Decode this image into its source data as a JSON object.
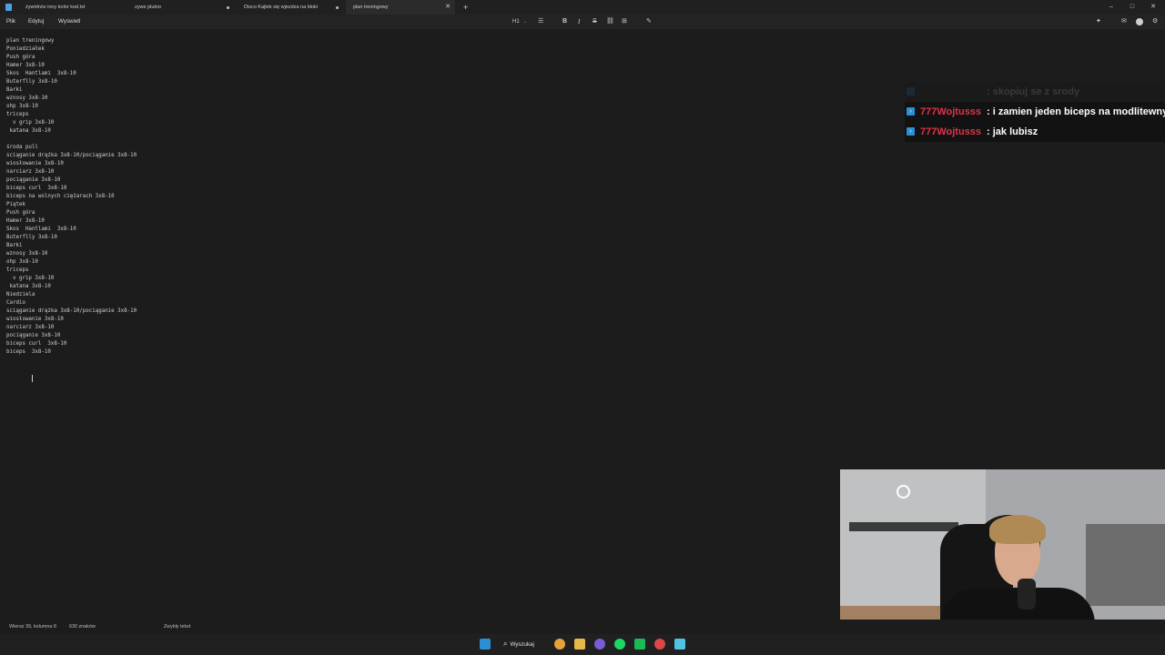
{
  "tabs": [
    {
      "label": "żywidnóz inny kolor kod.txt",
      "active": false,
      "dirty": false
    },
    {
      "label": "zywe plutno",
      "active": false,
      "dirty": true
    },
    {
      "label": "Disco Kajtek się wjezdza na bloki",
      "active": false,
      "dirty": true
    },
    {
      "label": "plan treningowy",
      "active": true,
      "dirty": false
    }
  ],
  "new_tab": "+",
  "window_controls": {
    "minimize": "–",
    "maximize": "□",
    "close": "✕"
  },
  "menu": {
    "file": "Plik",
    "edit": "Edytuj",
    "view": "Wyświetl"
  },
  "toolbar": {
    "heading": "H1",
    "list": "☰",
    "bold": "B",
    "italic": "I",
    "strike": "S",
    "link": "⛓",
    "table": "⊞",
    "clear": "✎"
  },
  "document_lines": [
    "plan treningowy",
    "Poniedziałek",
    "Push góra",
    "Hamer 3x8-10",
    "Skos  Hantlami  3x8-10",
    "Buterflly 3x8-10",
    "Barki",
    "wznosy 3x8-10",
    "ohp 3x8-10",
    "triceps",
    "  v grip 3x8-10",
    " katana 3x8-10",
    "",
    "środa pull",
    "sciąganie drążka 3x8-10/pociąganie 3x8-10",
    "wiosłowanie 3x8-10",
    "narciarz 3x8-10",
    "pociąganie 3x8-10",
    "biceps curl  3x8-10",
    "biceps na wolnych ciężarach 3x8-10",
    "Piątek",
    "Push góra",
    "Hamer 3x8-10",
    "Skos  Hantlami  3x8-10",
    "Buterflly 3x8-10",
    "Barki",
    "wznosy 3x8-10",
    "ohp 3x8-10",
    "triceps",
    "  v grip 3x8-10",
    " katana 3x8-10",
    "Niedziela",
    "Cardio",
    "sciąganie drążka 3x8-10/pociąganie 3x8-10",
    "wiosłowanie 3x8-10",
    "narciarz 3x8-10",
    "pociąganie 3x8-10",
    "biceps curl  3x8-10",
    "biceps  3x8-10"
  ],
  "chat": [
    {
      "user": "",
      "message": ": skopiuj se z srody",
      "faded": true
    },
    {
      "user": "777Wojtusss",
      "message": ": i zamien jeden biceps na modlitewny",
      "faded": false
    },
    {
      "user": "777Wojtusss",
      "message": ": jak lubisz",
      "faded": false
    }
  ],
  "status": {
    "position": "Wiersz 39, kolumna 8",
    "chars": "630 znaków",
    "format": "Zwykły tekst"
  },
  "taskbar": {
    "search": "Wyszukaj"
  },
  "colors": {
    "accent": "#2b8fd4",
    "chat_user": "#e0334a"
  }
}
